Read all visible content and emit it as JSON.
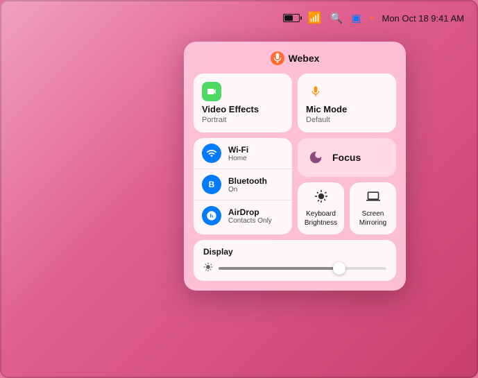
{
  "desktop": {
    "bg_color": "#e06090"
  },
  "menubar": {
    "time": "Mon Oct 18  9:41 AM",
    "battery_label": "battery",
    "wifi_label": "wifi",
    "search_label": "search",
    "screen_mirror_label": "screen-mirroring"
  },
  "control_center": {
    "webex_label": "Webex",
    "sections": {
      "video_effects": {
        "title": "Video Effects",
        "subtitle": "Portrait"
      },
      "mic_mode": {
        "title": "Mic Mode",
        "subtitle": "Default"
      },
      "wifi": {
        "name": "Wi-Fi",
        "status": "Home"
      },
      "bluetooth": {
        "name": "Bluetooth",
        "status": "On"
      },
      "airdrop": {
        "name": "AirDrop",
        "status": "Contacts Only"
      },
      "focus": {
        "label": "Focus"
      },
      "keyboard_brightness": {
        "label": "Keyboard\nBrightness",
        "line1": "Keyboard",
        "line2": "Brightness"
      },
      "screen_mirroring": {
        "label": "Screen\nMirroring",
        "line1": "Screen",
        "line2": "Mirroring"
      },
      "display": {
        "label": "Display",
        "brightness_pct": 72
      }
    }
  }
}
